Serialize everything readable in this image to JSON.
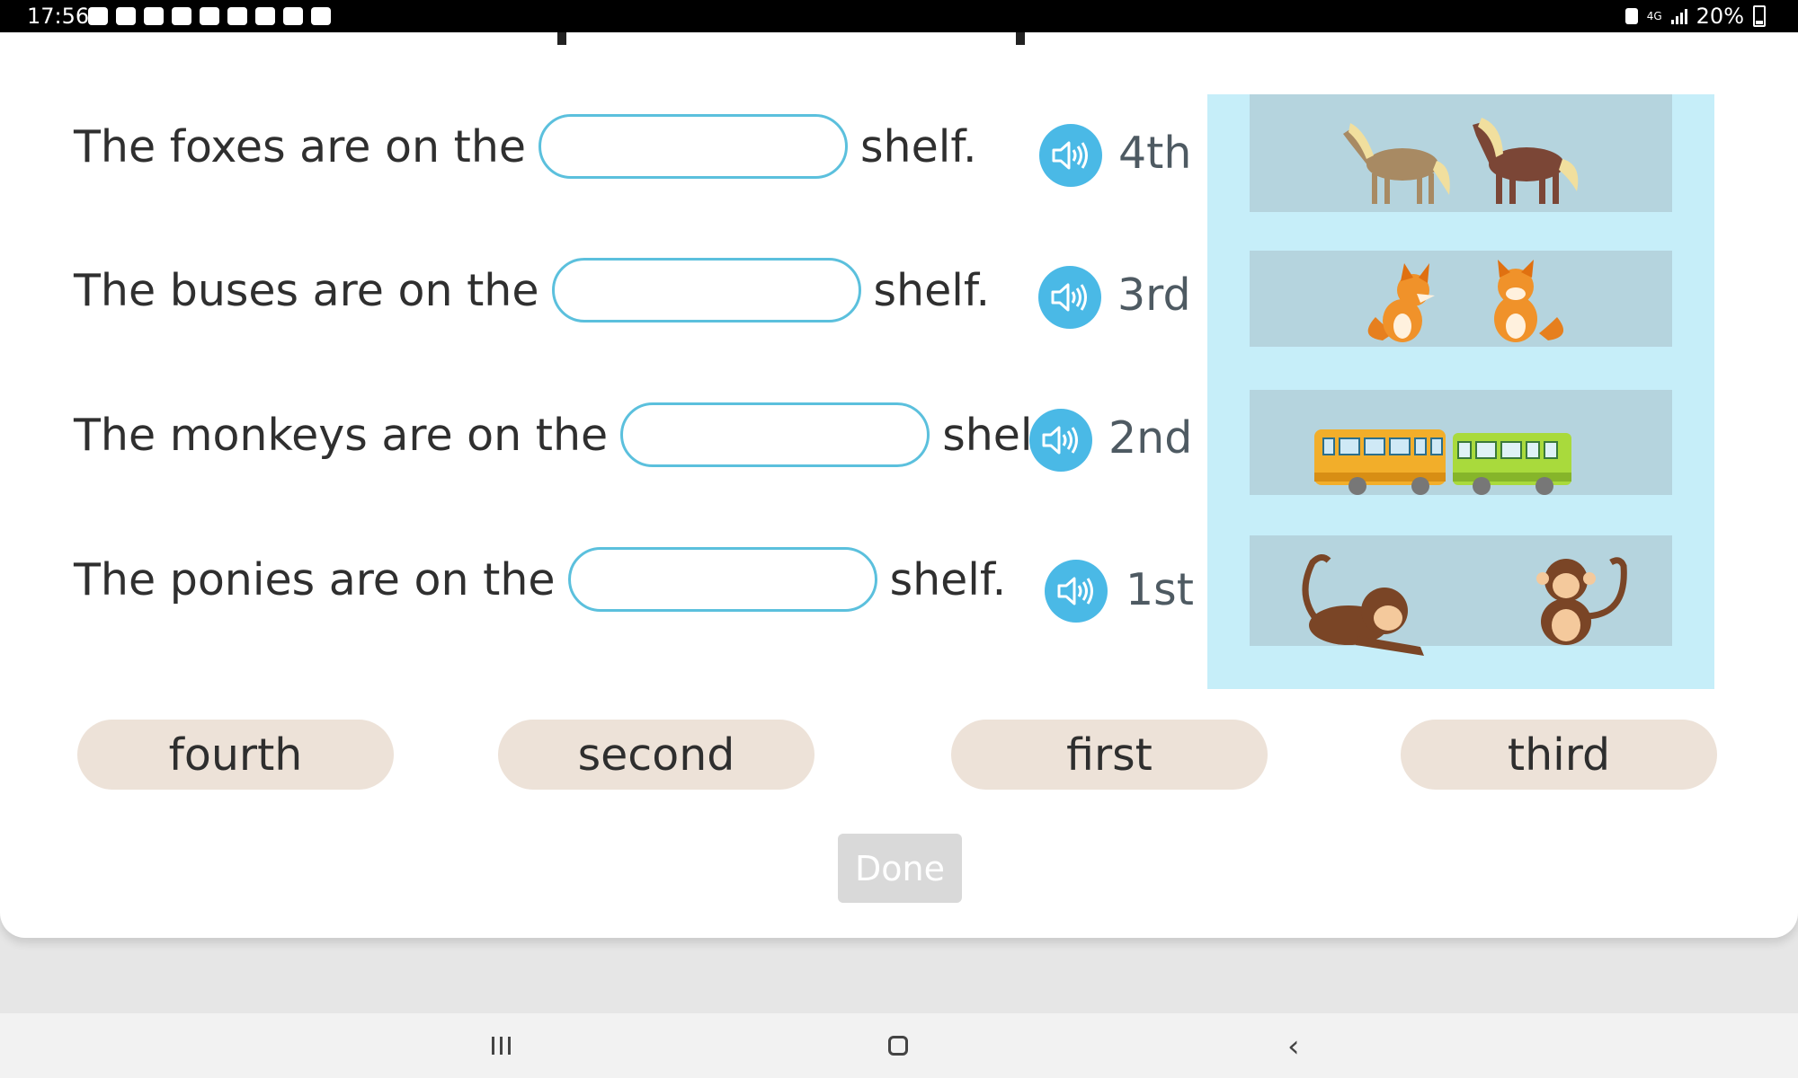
{
  "status_bar": {
    "time": "17:56",
    "network": "4G",
    "battery": "20%"
  },
  "exercise": {
    "sentences": [
      {
        "before": "The foxes are on the",
        "answer": "",
        "after": "shelf."
      },
      {
        "before": "The buses are on the",
        "answer": "",
        "after": "shelf."
      },
      {
        "before": "The monkeys are on the",
        "answer": "",
        "after": "shelf."
      },
      {
        "before": "The ponies are on the",
        "answer": "",
        "after": "shelf."
      }
    ],
    "shelf_labels": [
      "4th",
      "3rd",
      "2nd",
      "1st"
    ],
    "shelves": [
      {
        "content": "ponies"
      },
      {
        "content": "foxes"
      },
      {
        "content": "buses"
      },
      {
        "content": "monkeys"
      }
    ],
    "word_bank": [
      "fourth",
      "second",
      "first",
      "third"
    ],
    "done_label": "Done"
  },
  "colors": {
    "blank_border": "#5bc0dd",
    "audio_button": "#4ab9e6",
    "shelf_frame": "#c6eef9",
    "shelf": "#b5d4de",
    "chip": "#ede2d8",
    "done_disabled": "#d9d9d9"
  },
  "icons": {
    "audio": "speaker-icon",
    "nav_recent": "recent-apps-icon",
    "nav_home": "home-icon",
    "nav_back": "back-icon"
  }
}
